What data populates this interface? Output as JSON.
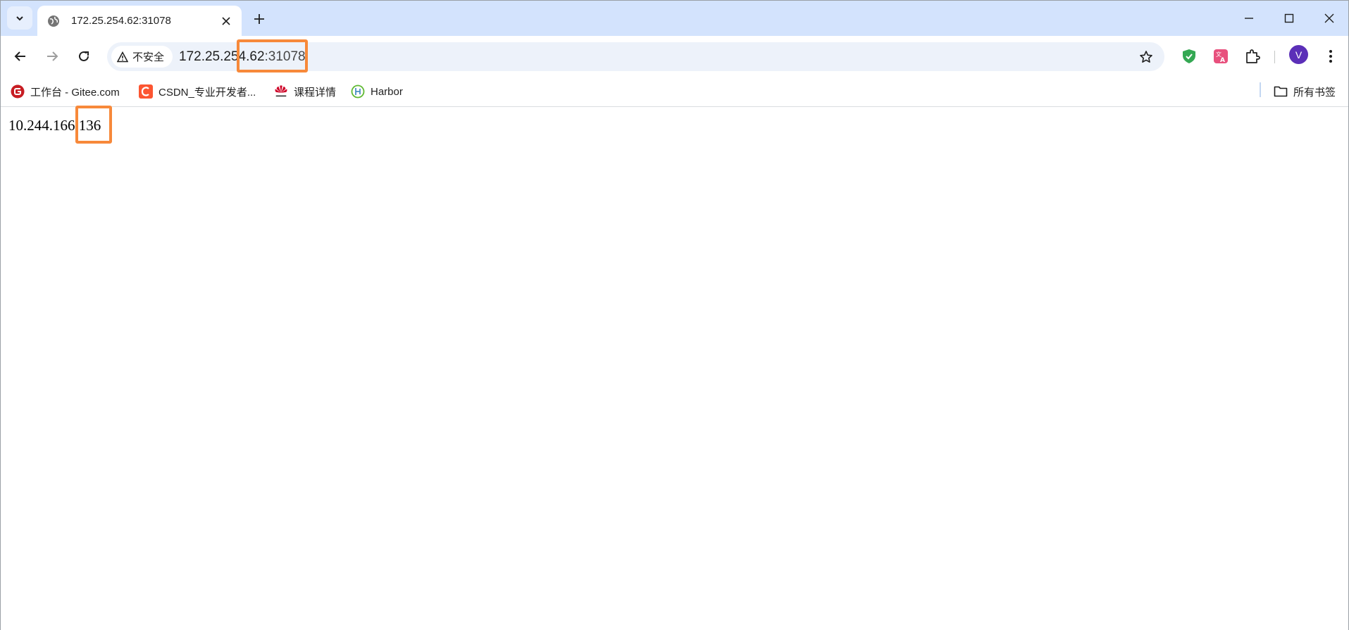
{
  "tab": {
    "title": "172.25.254.62:31078"
  },
  "omnibox": {
    "security_label": "不安全",
    "url_host": "172.25.254.62",
    "url_port": ":31078"
  },
  "profile": {
    "initial": "V"
  },
  "bookmarks": {
    "items": [
      {
        "label": "工作台 - Gitee.com",
        "icon": "gitee-icon"
      },
      {
        "label": "CSDN_专业开发者...",
        "icon": "csdn-icon"
      },
      {
        "label": "课程详情",
        "icon": "huawei-icon"
      },
      {
        "label": "Harbor",
        "icon": "harbor-icon"
      }
    ],
    "all_bookmarks_label": "所有书签"
  },
  "page": {
    "body_text": "10.244.166.136"
  },
  "colors": {
    "accent": "#f7893a",
    "tabstrip": "#d3e3fd",
    "omnibox": "#edf2fa",
    "avatar": "#5b2fb8"
  }
}
